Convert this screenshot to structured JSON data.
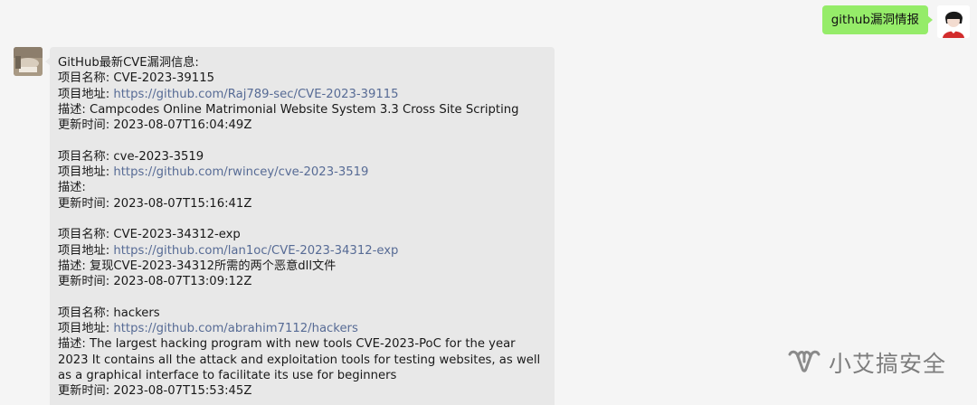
{
  "conversation": {
    "outgoing": {
      "text": "github漏洞情报"
    },
    "incoming": {
      "header": "GitHub最新CVE漏洞信息:",
      "labels": {
        "name": "项目名称: ",
        "url": "项目地址: ",
        "desc": "描述: ",
        "time": "更新时间: "
      },
      "entries": [
        {
          "name": "CVE-2023-39115",
          "url": "https://github.com/Raj789-sec/CVE-2023-39115",
          "desc": "Campcodes Online Matrimonial Website System 3.3 Cross Site Scripting",
          "time": "2023-08-07T16:04:49Z"
        },
        {
          "name": "cve-2023-3519",
          "url": "https://github.com/rwincey/cve-2023-3519",
          "desc": "",
          "time": "2023-08-07T15:16:41Z"
        },
        {
          "name": "CVE-2023-34312-exp",
          "url": "https://github.com/lan1oc/CVE-2023-34312-exp",
          "desc": "复现CVE-2023-34312所需的两个恶意dll文件",
          "time": "2023-08-07T13:09:12Z"
        },
        {
          "name": "hackers",
          "url": "https://github.com/abrahim7112/hackers",
          "desc": "The largest hacking program with new tools CVE-2023-PoC for the year 2023 It contains all the attack and exploitation tools for testing websites, as well as a graphical interface to facilitate its use for beginners",
          "time": "2023-08-07T15:53:45Z"
        }
      ]
    }
  },
  "watermark": {
    "text": "小艾搞安全",
    "icon": "wechat-channel-icon"
  },
  "colors": {
    "outgoing_bubble": "#95ec69",
    "incoming_bubble": "#e8e8e8",
    "link": "#576b95",
    "background": "#f5f5f5"
  }
}
